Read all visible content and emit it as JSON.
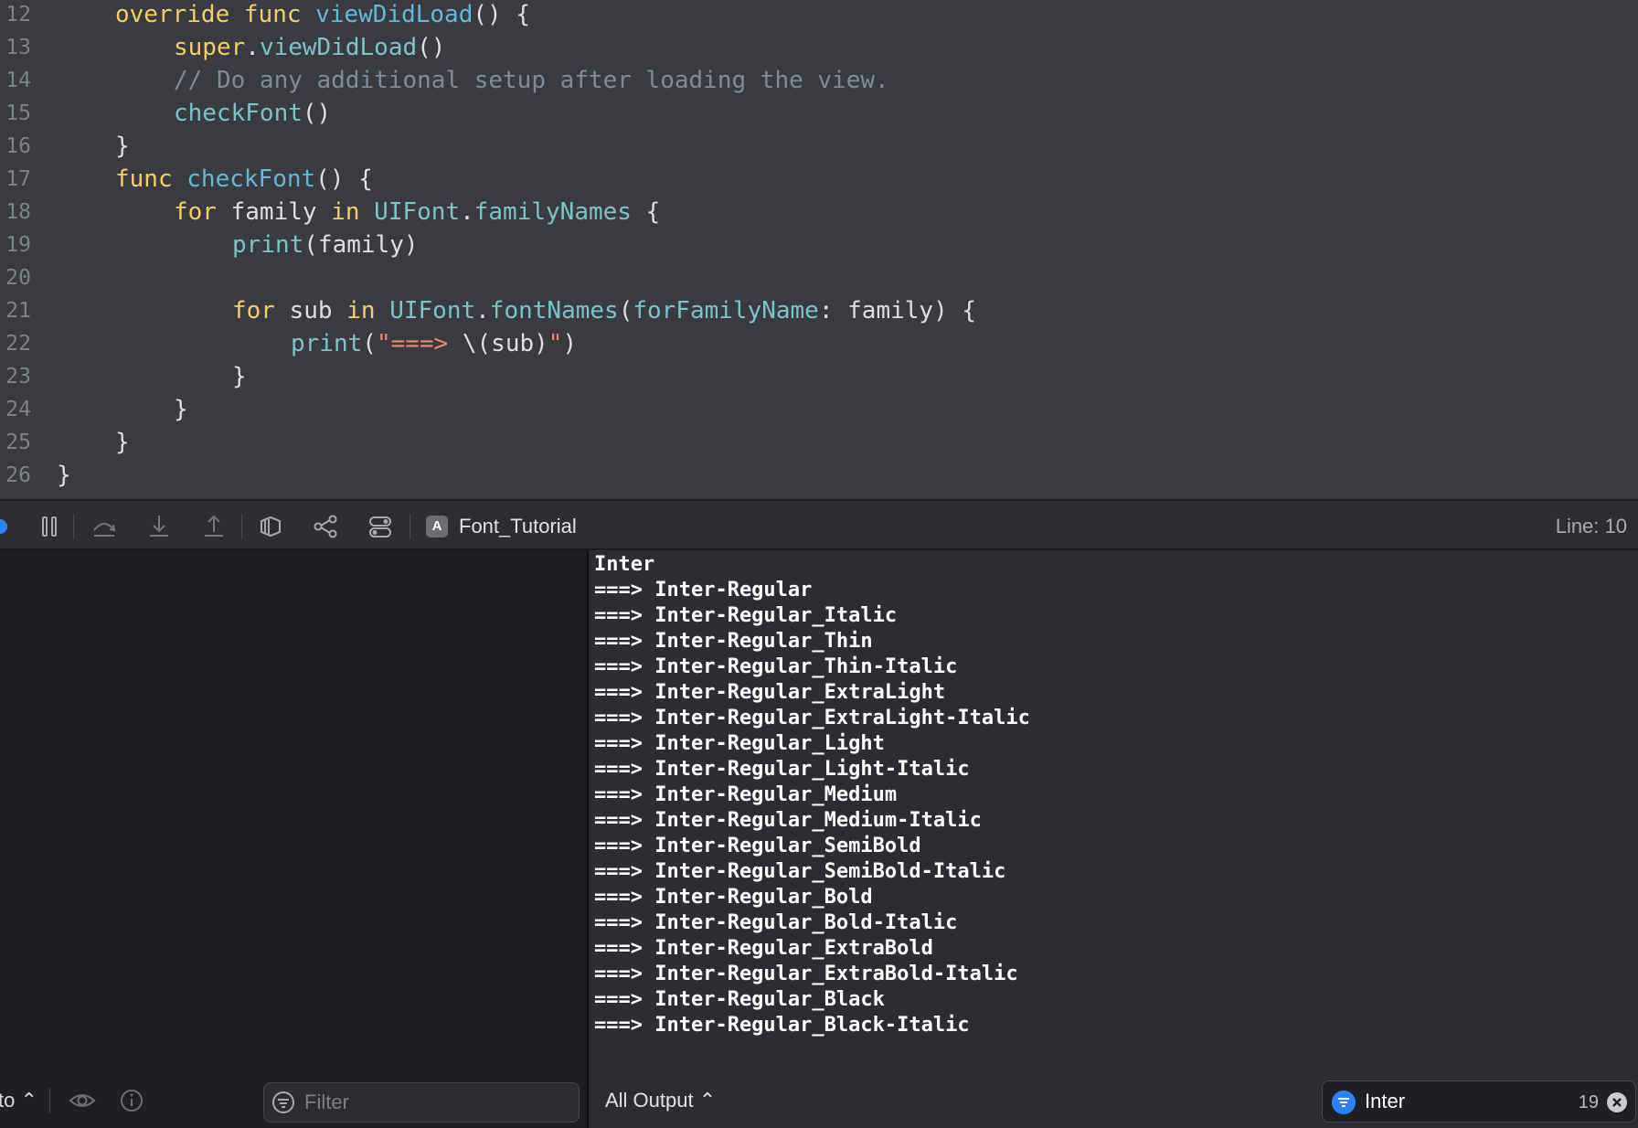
{
  "editor": {
    "lines": [
      {
        "num": "12",
        "indent": 1,
        "tokens": [
          {
            "t": "override ",
            "c": "kw"
          },
          {
            "t": "func ",
            "c": "kw"
          },
          {
            "t": "viewDidLoad",
            "c": "fn"
          },
          {
            "t": "() {",
            "c": "pl"
          }
        ]
      },
      {
        "num": "13",
        "indent": 2,
        "tokens": [
          {
            "t": "super",
            "c": "kw"
          },
          {
            "t": ".",
            "c": "pl"
          },
          {
            "t": "viewDidLoad",
            "c": "ty"
          },
          {
            "t": "()",
            "c": "pl"
          }
        ]
      },
      {
        "num": "14",
        "indent": 2,
        "tokens": [
          {
            "t": "// Do any additional setup after loading the view.",
            "c": "cm"
          }
        ]
      },
      {
        "num": "15",
        "indent": 2,
        "tokens": [
          {
            "t": "checkFont",
            "c": "ty"
          },
          {
            "t": "()",
            "c": "pl"
          }
        ]
      },
      {
        "num": "16",
        "indent": 1,
        "tokens": [
          {
            "t": "}",
            "c": "pl"
          }
        ]
      },
      {
        "num": "17",
        "indent": 1,
        "tokens": [
          {
            "t": "func ",
            "c": "kw"
          },
          {
            "t": "checkFont",
            "c": "fn"
          },
          {
            "t": "() {",
            "c": "pl"
          }
        ]
      },
      {
        "num": "18",
        "indent": 2,
        "tokens": [
          {
            "t": "for ",
            "c": "kw"
          },
          {
            "t": "family ",
            "c": "pl"
          },
          {
            "t": "in ",
            "c": "kw"
          },
          {
            "t": "UIFont",
            "c": "ty"
          },
          {
            "t": ".",
            "c": "pl"
          },
          {
            "t": "familyNames",
            "c": "ty"
          },
          {
            "t": " {",
            "c": "pl"
          }
        ]
      },
      {
        "num": "19",
        "indent": 3,
        "tokens": [
          {
            "t": "print",
            "c": "ty"
          },
          {
            "t": "(family)",
            "c": "pl"
          }
        ]
      },
      {
        "num": "20",
        "indent": 0,
        "tokens": []
      },
      {
        "num": "21",
        "indent": 3,
        "tokens": [
          {
            "t": "for ",
            "c": "kw"
          },
          {
            "t": "sub ",
            "c": "pl"
          },
          {
            "t": "in ",
            "c": "kw"
          },
          {
            "t": "UIFont",
            "c": "ty"
          },
          {
            "t": ".",
            "c": "pl"
          },
          {
            "t": "fontNames",
            "c": "ty"
          },
          {
            "t": "(",
            "c": "pl"
          },
          {
            "t": "forFamilyName",
            "c": "ty"
          },
          {
            "t": ": family) {",
            "c": "pl"
          }
        ]
      },
      {
        "num": "22",
        "indent": 4,
        "tokens": [
          {
            "t": "print",
            "c": "ty"
          },
          {
            "t": "(",
            "c": "pl"
          },
          {
            "t": "\"===> ",
            "c": "st"
          },
          {
            "t": "\\(sub)",
            "c": "pl"
          },
          {
            "t": "\"",
            "c": "st"
          },
          {
            "t": ")",
            "c": "pl"
          }
        ]
      },
      {
        "num": "23",
        "indent": 3,
        "tokens": [
          {
            "t": "}",
            "c": "pl"
          }
        ]
      },
      {
        "num": "24",
        "indent": 2,
        "tokens": [
          {
            "t": "}",
            "c": "pl"
          }
        ]
      },
      {
        "num": "25",
        "indent": 1,
        "tokens": [
          {
            "t": "}",
            "c": "pl"
          }
        ]
      },
      {
        "num": "26",
        "indent": 0,
        "tokens": [
          {
            "t": "}",
            "c": "pl"
          }
        ]
      }
    ]
  },
  "debug_bar": {
    "target_name": "Font_Tutorial",
    "app_icon_glyph": "A",
    "line_indicator": "Line: 10",
    "icons": [
      "pause-icon",
      "step-over-icon",
      "step-into-icon",
      "step-out-icon",
      "view-hierarchy-icon",
      "memory-graph-icon",
      "environment-overrides-icon"
    ]
  },
  "variables": {
    "scope_label": "to ⌃",
    "filter_placeholder": "Filter"
  },
  "console": {
    "lines": [
      "Inter",
      "===> Inter-Regular",
      "===> Inter-Regular_Italic",
      "===> Inter-Regular_Thin",
      "===> Inter-Regular_Thin-Italic",
      "===> Inter-Regular_ExtraLight",
      "===> Inter-Regular_ExtraLight-Italic",
      "===> Inter-Regular_Light",
      "===> Inter-Regular_Light-Italic",
      "===> Inter-Regular_Medium",
      "===> Inter-Regular_Medium-Italic",
      "===> Inter-Regular_SemiBold",
      "===> Inter-Regular_SemiBold-Italic",
      "===> Inter-Regular_Bold",
      "===> Inter-Regular_Bold-Italic",
      "===> Inter-Regular_ExtraBold",
      "===> Inter-Regular_ExtraBold-Italic",
      "===> Inter-Regular_Black",
      "===> Inter-Regular_Black-Italic"
    ],
    "output_select": "All Output ⌃",
    "search_value": "Inter",
    "match_count": "19"
  },
  "colors": {
    "accent": "#2f7ff6",
    "editor_bg": "#393b41",
    "console_bg": "#2c2d32"
  }
}
